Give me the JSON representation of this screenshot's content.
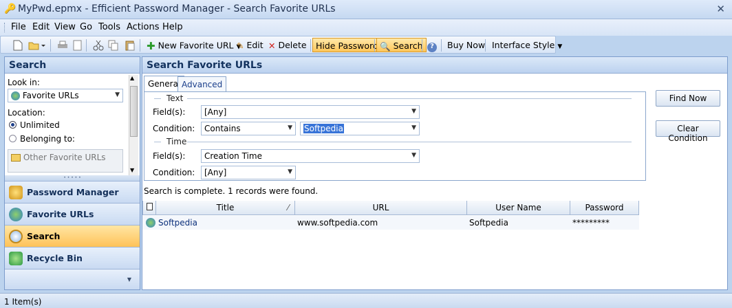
{
  "window": {
    "title": "MyPwd.epmx - Efficient Password Manager - Search Favorite URLs",
    "close_glyph": "✕"
  },
  "menu": [
    "File",
    "Edit",
    "View",
    "Go",
    "Tools",
    "Actions",
    "Help"
  ],
  "toolbar": {
    "new_favorite_url": "New Favorite URL",
    "edit": "Edit",
    "delete": "Delete",
    "hide_password": "Hide Password",
    "search": "Search",
    "buy_now": "Buy Now",
    "interface_style": "Interface Style"
  },
  "left_pane": {
    "header": "Search",
    "look_in_label": "Look in:",
    "look_in_value": "Favorite URLs",
    "location_label": "Location:",
    "opt_unlimited": "Unlimited",
    "opt_belonging": "Belonging to:",
    "folder_value": "Other Favorite URLs",
    "nav": [
      {
        "label": "Password Manager"
      },
      {
        "label": "Favorite URLs"
      },
      {
        "label": "Search"
      },
      {
        "label": "Recycle Bin"
      }
    ]
  },
  "right_pane": {
    "header": "Search Favorite URLs",
    "tabs": [
      "General",
      "Advanced"
    ],
    "text_group": "Text",
    "time_group": "Time",
    "fields_label": "Field(s):",
    "condition_label": "Condition:",
    "text_fields_value": "[Any]",
    "text_condition_value": "Contains",
    "text_query_value": "Softpedia",
    "time_fields_value": "Creation Time",
    "time_condition_value": "[Any]",
    "find_now": "Find Now",
    "clear_condition": "Clear Condition",
    "result_status": "Search is complete. 1 records were found.",
    "columns": [
      "Title",
      "URL",
      "User Name",
      "Password"
    ],
    "rows": [
      {
        "title": "Softpedia",
        "url": "www.softpedia.com",
        "user": "Softpedia",
        "password": "*********"
      }
    ]
  },
  "status": {
    "text": "1 Item(s)"
  },
  "colors": {
    "accent_hot": "#ffc65a",
    "header_text": "#13325e",
    "selection": "#3874d8"
  }
}
